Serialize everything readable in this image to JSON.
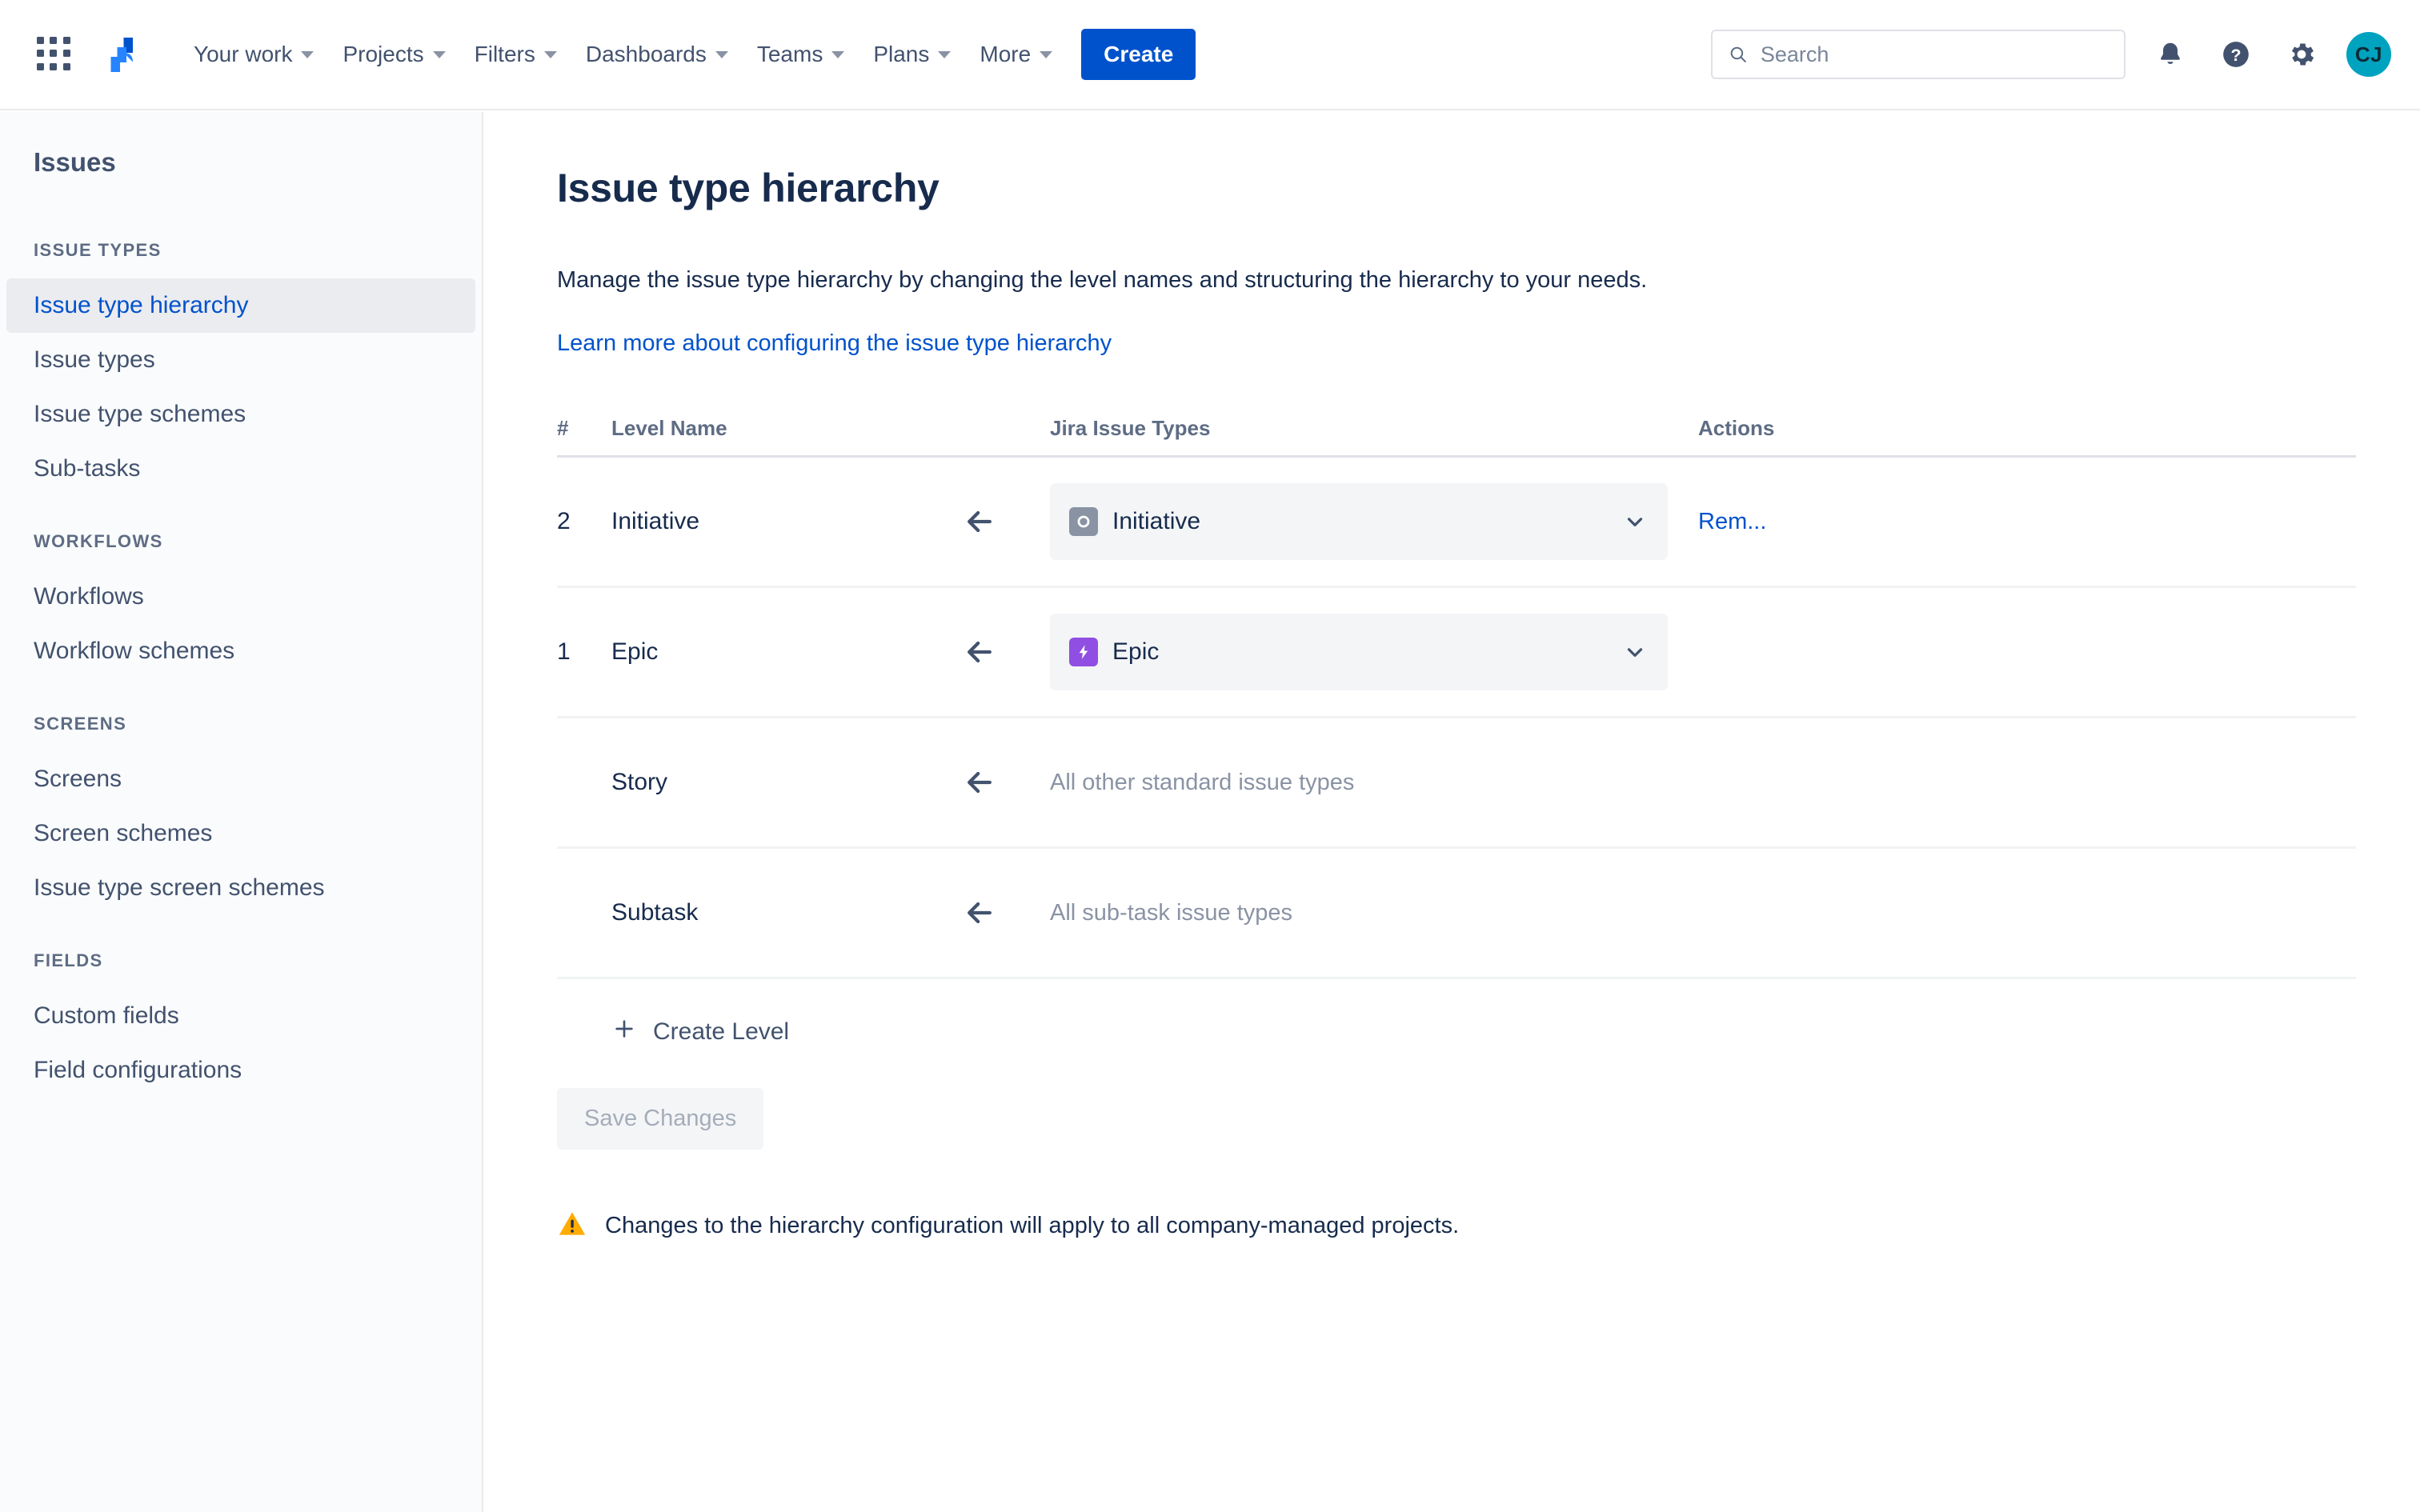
{
  "topnav": {
    "apps_icon": "apps-grid-icon",
    "logo_icon": "jira-logo-icon",
    "items": [
      {
        "label": "Your work",
        "has_caret": true
      },
      {
        "label": "Projects",
        "has_caret": true
      },
      {
        "label": "Filters",
        "has_caret": true
      },
      {
        "label": "Dashboards",
        "has_caret": true
      },
      {
        "label": "Teams",
        "has_caret": true
      },
      {
        "label": "Plans",
        "has_caret": true
      },
      {
        "label": "More",
        "has_caret": true
      }
    ],
    "create_label": "Create",
    "search": {
      "value": "",
      "placeholder": "Search",
      "icon": "search-icon"
    },
    "notifications_icon": "bell-icon",
    "help_icon": "help-circle-icon",
    "settings_icon": "gear-icon",
    "avatar": {
      "initials": "CJ",
      "color": "#00A3BF"
    }
  },
  "sidebar": {
    "title": "Issues",
    "sections": [
      {
        "heading": "ISSUE TYPES",
        "items": [
          {
            "label": "Issue type hierarchy",
            "active": true
          },
          {
            "label": "Issue types",
            "active": false
          },
          {
            "label": "Issue type schemes",
            "active": false
          },
          {
            "label": "Sub-tasks",
            "active": false
          }
        ]
      },
      {
        "heading": "WORKFLOWS",
        "items": [
          {
            "label": "Workflows",
            "active": false
          },
          {
            "label": "Workflow schemes",
            "active": false
          }
        ]
      },
      {
        "heading": "SCREENS",
        "items": [
          {
            "label": "Screens",
            "active": false
          },
          {
            "label": "Screen schemes",
            "active": false
          },
          {
            "label": "Issue type screen schemes",
            "active": false
          }
        ]
      },
      {
        "heading": "FIELDS",
        "items": [
          {
            "label": "Custom fields",
            "active": false
          },
          {
            "label": "Field configurations",
            "active": false
          }
        ]
      }
    ]
  },
  "main": {
    "page_title": "Issue type hierarchy",
    "description": "Manage the issue type hierarchy by changing the level names and structuring the hierarchy to your needs.",
    "learn_more_link": "Learn more about configuring the issue type hierarchy",
    "table": {
      "headers": {
        "number": "#",
        "level_name": "Level Name",
        "jira_issue_types": "Jira Issue Types",
        "actions": "Actions"
      },
      "rows": [
        {
          "number": "2",
          "level_name": "Initiative",
          "arrow_icon": "arrow-left-icon",
          "select": {
            "value": "Initiative",
            "badge_icon": "initiative-icon",
            "badge_color": "#8993A4",
            "caret_icon": "chevron-down-icon",
            "is_select": true
          },
          "action_label": "Rem..."
        },
        {
          "number": "1",
          "level_name": "Epic",
          "arrow_icon": "arrow-left-icon",
          "select": {
            "value": "Epic",
            "badge_icon": "epic-bolt-icon",
            "badge_color": "#904EE2",
            "caret_icon": "chevron-down-icon",
            "is_select": true
          },
          "action_label": ""
        },
        {
          "number": "",
          "level_name": "Story",
          "arrow_icon": "arrow-left-icon",
          "select": {
            "value": "All other standard issue types",
            "is_select": false
          },
          "action_label": ""
        },
        {
          "number": "",
          "level_name": "Subtask",
          "arrow_icon": "arrow-left-icon",
          "select": {
            "value": "All sub-task issue types",
            "is_select": false
          },
          "action_label": ""
        }
      ]
    },
    "create_level_label": "Create Level",
    "create_level_icon": "plus-icon",
    "save_button_label": "Save Changes",
    "save_button_disabled": true,
    "warning": {
      "icon": "warning-triangle-icon",
      "color": "#FFAB00",
      "text": "Changes to the hierarchy configuration will apply to all company-managed projects."
    }
  }
}
